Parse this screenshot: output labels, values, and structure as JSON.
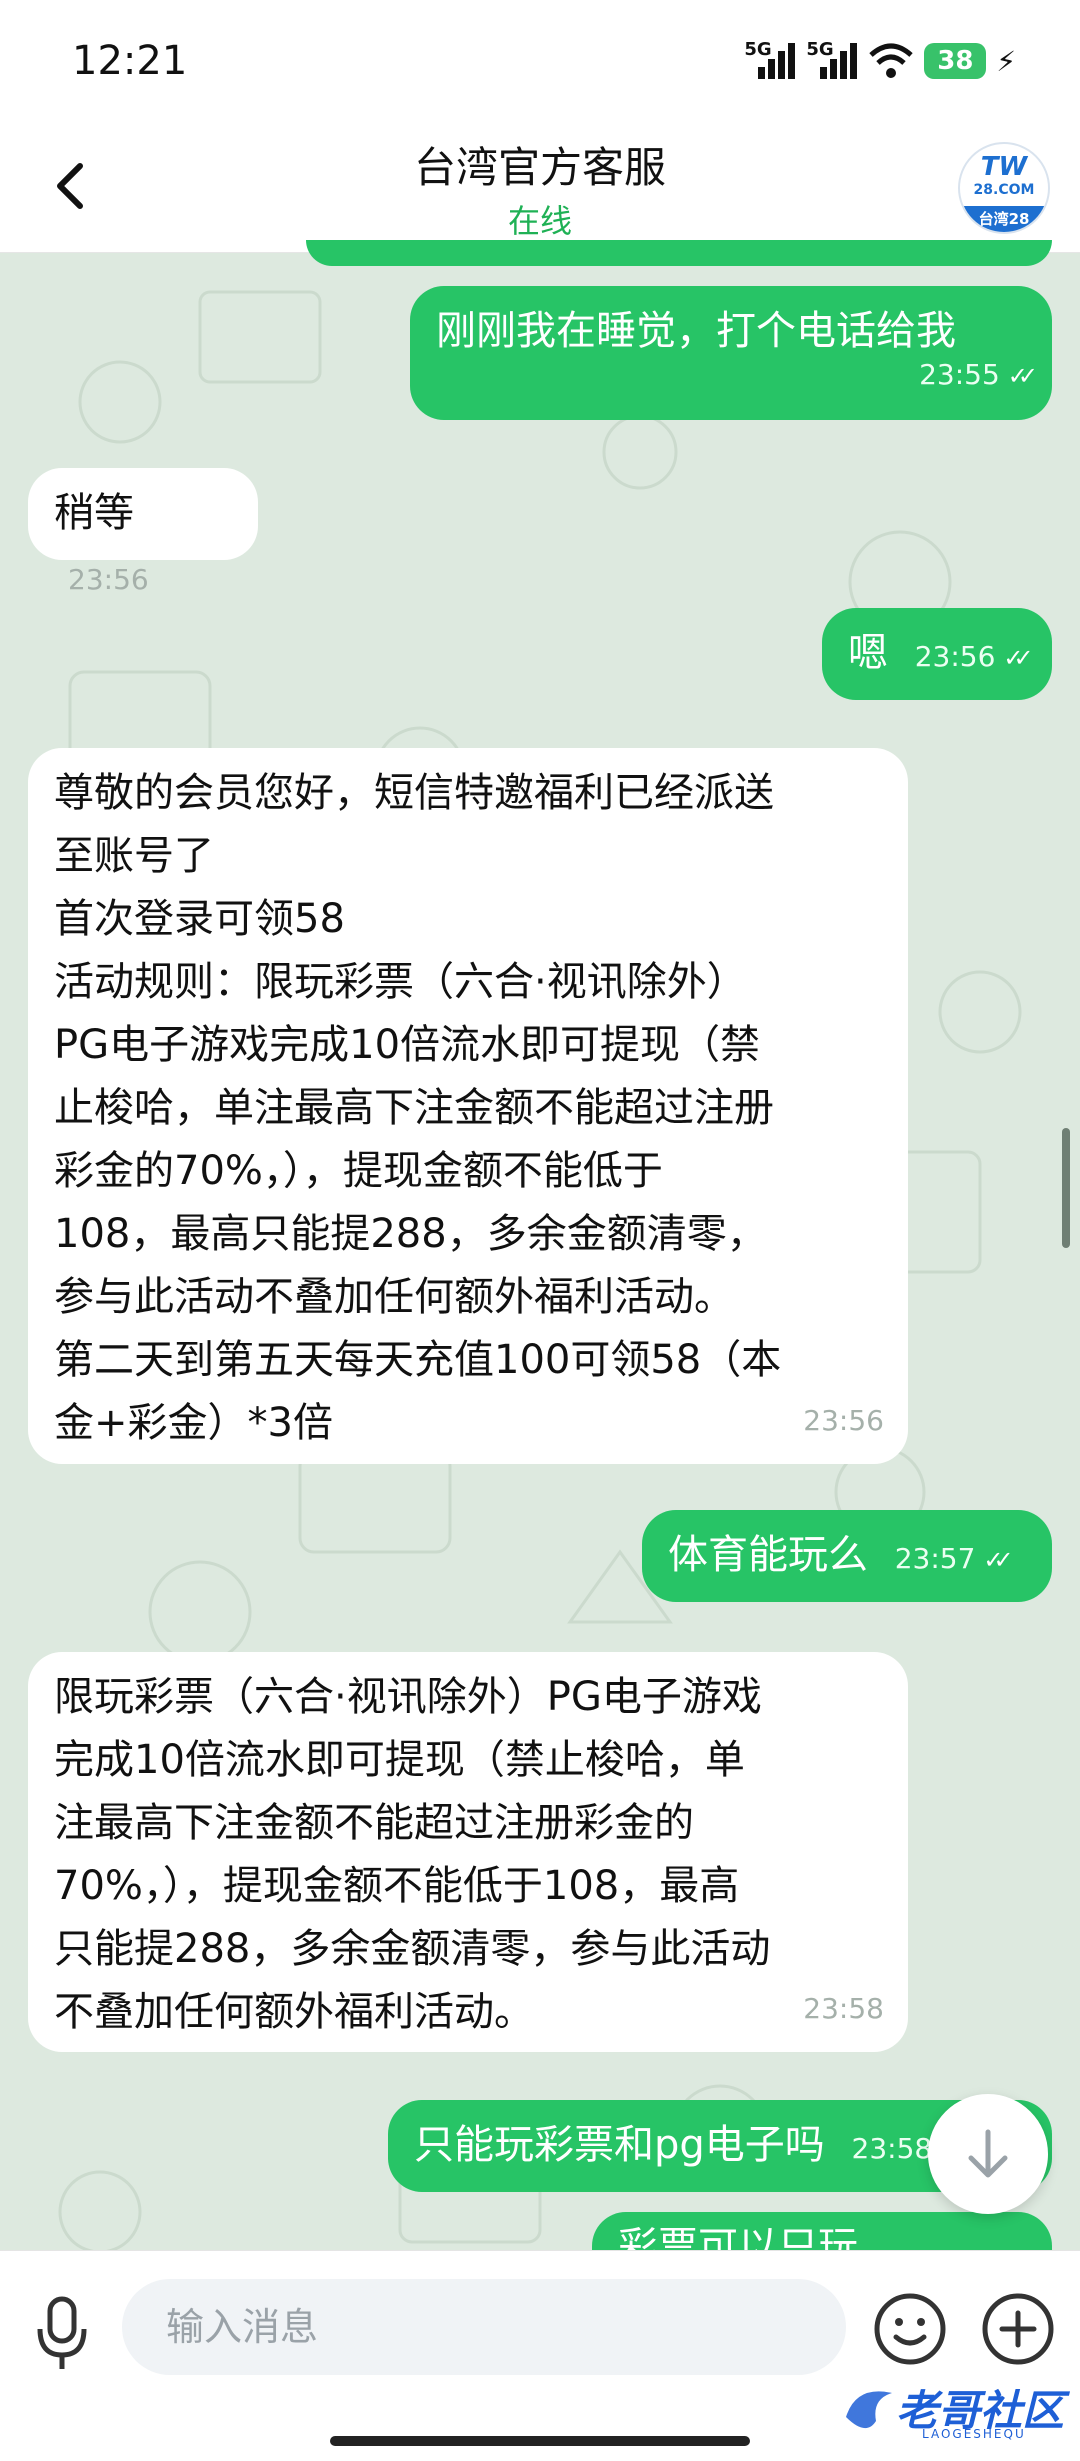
{
  "status_bar": {
    "time": "12:21",
    "signal_label": "5G",
    "battery": "38"
  },
  "header": {
    "title": "台湾官方客服",
    "status": "在线",
    "avatar": {
      "line1": "TW",
      "line2": "28.COM",
      "line3": "台湾28"
    }
  },
  "messages": [
    {
      "dir": "out",
      "text": "刚刚我在睡觉，打个电话给我",
      "time": "23:55"
    },
    {
      "dir": "in",
      "text": "稍等",
      "time": "23:56"
    },
    {
      "dir": "out",
      "text": "嗯",
      "time": "23:56"
    },
    {
      "dir": "in",
      "text": "尊敬的会员您好，短信特邀福利已经派送\n至账号了\n首次登录可领58\n活动规则：限玩彩票（六合·视讯除外）\nPG电子游戏完成10倍流水即可提现（禁\n止梭哈，单注最高下注金额不能超过注册\n彩金的70%，），提现金额不能低于\n108，最高只能提288，多余金额清零，\n参与此活动不叠加任何额外福利活动。\n第二天到第五天每天充值100可领58（本\n金+彩金）*3倍",
      "time": "23:56"
    },
    {
      "dir": "out",
      "text": "体育能玩么",
      "time": "23:57"
    },
    {
      "dir": "in",
      "text": "限玩彩票（六合·视讯除外）PG电子游戏\n完成10倍流水即可提现（禁止梭哈，单\n注最高下注金额不能超过注册彩金的\n70%，），提现金额不能低于108，最高\n只能提288，多余金额清零，参与此活动\n不叠加任何额外福利活动。",
      "time": "23:58"
    },
    {
      "dir": "out",
      "text": "只能玩彩票和pg电子吗",
      "time": "23:58"
    },
    {
      "dir": "out",
      "text": "彩票可以只玩",
      "time": ""
    }
  ],
  "input": {
    "placeholder": "输入消息"
  },
  "watermark": {
    "text": "老哥社区",
    "sub": "LAOGESHEQU"
  },
  "colors": {
    "outgoing": "#27c466",
    "incoming": "#ffffff",
    "online": "#1fb155",
    "background": "#dde9df"
  }
}
